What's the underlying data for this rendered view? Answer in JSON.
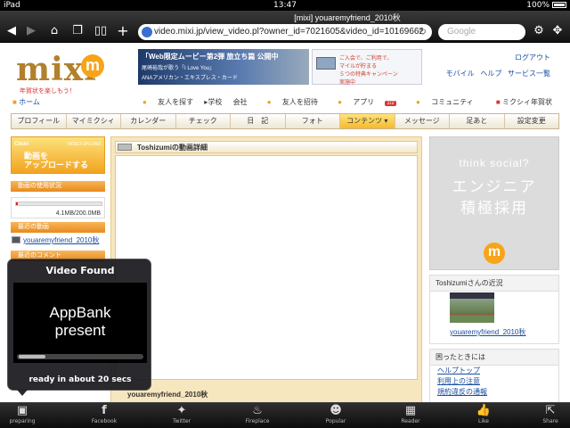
{
  "status": {
    "carrier": "iPad",
    "time": "13:47",
    "battery": "100%"
  },
  "browser": {
    "title": "[mixi] youaremyfriend_2010秋",
    "url": "video.mixi.jp/view_video.pl?owner_id=7021605&video_id=10169662",
    "search_placeholder": "Google"
  },
  "mixi": {
    "logo_text": "mixi",
    "logo_mark": "m",
    "tagline": "年賀状を楽しもう！",
    "banner_line1": "「Web限定ムービー第2弾 旅立ち篇 公開中",
    "banner_line2": "尾崎裕哉が歌う「I Love You」",
    "banner_line3": "ANAアメリカン・エキスプレス・カード",
    "banner2_line1": "ご入会で、ご利用で、",
    "banner2_line2": "マイルが貯まる",
    "banner2_line3": "５つの特典キャンペーン",
    "banner2_line4": "実施中",
    "links": {
      "logout": "ログアウト",
      "mobile": "モバイル",
      "help": "ヘルプ",
      "service": "サービス一覧"
    },
    "home": "ホーム",
    "actions": {
      "find": "友人を探す",
      "school": "学校",
      "company": "会社",
      "invite": "友人を招待",
      "apps": "アプリ",
      "apps_badge": "1/2",
      "community": "コミュニティ"
    },
    "year_card": "ミクシィ年賀状",
    "nav": [
      "プロフィール",
      "マイミクシィ",
      "カレンダー",
      "チェック",
      "日　記",
      "フォト",
      "コンテンツ ▾",
      "メッセージ",
      "足あと",
      "設定変更"
    ],
    "upload": {
      "click": "Click!",
      "line1": "動画を",
      "line2": "アップロードする",
      "sub": "VIDEO UPLOAD"
    },
    "usage_head": "動画の使用状況",
    "usage_value": "4.1MB/200.0MB",
    "usage_fraction": 0.02,
    "recent_head": "最近の動画",
    "recent_video": "youaremyfriend_2010秋",
    "comment_head": "最近のコメント",
    "main_title": "Toshizumiの動画詳細",
    "video_title": "youaremyfriend_2010秋",
    "ad_line1": "think social?",
    "ad_line2": "エンジニア",
    "ad_line3": "積極採用",
    "ad_mark": "m",
    "near_head": "Toshizumiさんの近況",
    "near_caption": "youaremyfriend_2010秋",
    "help_head": "困ったときには",
    "help_links": [
      "ヘルプトップ",
      "利用上の注意",
      "規約違反の通報"
    ]
  },
  "overlay": {
    "title": "Video Found",
    "preview_line1": "AppBank",
    "preview_line2": "present",
    "status": "ready in about 20 secs"
  },
  "tabs": [
    {
      "icon": "preparing-icon",
      "label": "preparing"
    },
    {
      "icon": "facebook-icon",
      "label": "Facebook"
    },
    {
      "icon": "twitter-icon",
      "label": "Twitter"
    },
    {
      "icon": "fireplace-icon",
      "label": "Fireplace"
    },
    {
      "icon": "popular-icon",
      "label": "Popular"
    },
    {
      "icon": "reader-icon",
      "label": "Reader"
    },
    {
      "icon": "like-icon",
      "label": "Like"
    },
    {
      "icon": "share-icon",
      "label": "Share"
    }
  ]
}
